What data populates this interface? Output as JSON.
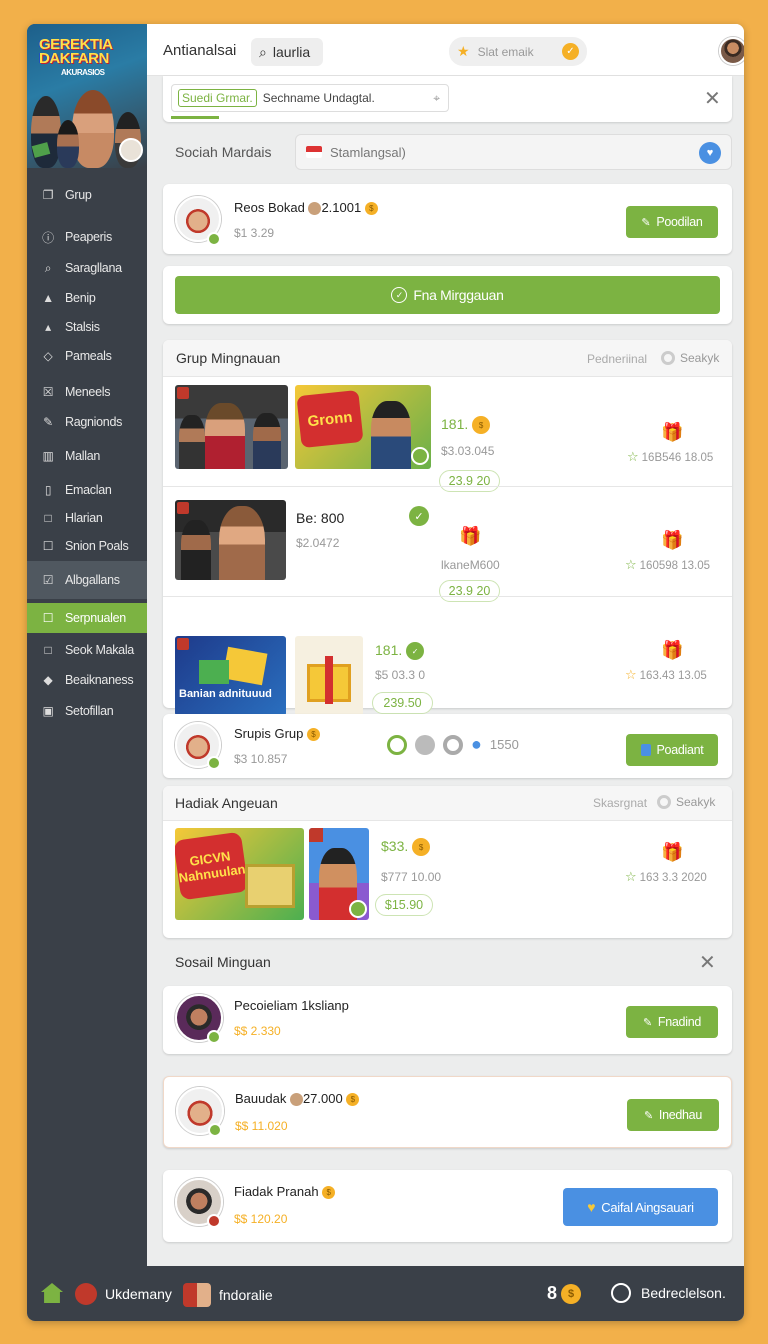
{
  "sidebar": {
    "hero_logo": "GEREKTIA DAKFARN",
    "hero_logo_small": "AKURASIOS",
    "items": [
      {
        "label": "Grup",
        "icon": "bookmark-icon"
      },
      {
        "label": "Peaperis",
        "icon": "info-icon"
      },
      {
        "label": "Saragllana",
        "icon": "search-icon"
      },
      {
        "label": "Benip",
        "icon": "person-icon"
      },
      {
        "label": "Stalsis",
        "icon": "thumb-up-icon"
      },
      {
        "label": "Pameals",
        "icon": "tag-icon"
      },
      {
        "label": "Meneels",
        "icon": "box-icon"
      },
      {
        "label": "Ragnionds",
        "icon": "edit-icon"
      },
      {
        "label": "Mallan",
        "icon": "grid-icon"
      },
      {
        "label": "Emaclan",
        "icon": "columns-icon"
      },
      {
        "label": "Hlarian",
        "icon": "square-icon"
      },
      {
        "label": "Snion Poals",
        "icon": "edit-icon"
      },
      {
        "label": "Albgallans",
        "icon": "checkbox-icon"
      },
      {
        "label": "Serpnualen",
        "icon": "edit-icon"
      },
      {
        "label": "Seok Makala",
        "icon": "square-icon"
      },
      {
        "label": "Beaiknaness",
        "icon": "shield-icon"
      },
      {
        "label": "Setofillan",
        "icon": "calendar-icon"
      }
    ]
  },
  "topbar": {
    "title": "Antianalsai",
    "search_label": "laurlia",
    "pill_text": "Slat emaik"
  },
  "notice": {
    "tag": "Suedi Grmar.",
    "text": "Sechname Undagtal."
  },
  "social_input": {
    "label": "Sociah Mardais",
    "placeholder": "Stamlangsal)"
  },
  "profile1": {
    "name": "Reos Bokad",
    "amount": "2.1001",
    "sub": "$1 3.29",
    "button": "Poodilan"
  },
  "wide_button": {
    "label": "Fna Mirggauan"
  },
  "group_section": {
    "title": "Grup Mingnauan",
    "right_text": "Pedneriinal",
    "right_action": "Seakyk",
    "rows": [
      {
        "name": "181.",
        "sub": "$3.03.045",
        "pill": "23.9 20",
        "stat": "16B546 18.05",
        "thumb_text": "Gronn"
      },
      {
        "name": "Be: 800",
        "sub": "$2.0472",
        "mid_text": "lkaneM600",
        "pill": "23.9 20",
        "stat": "160598 13.05"
      },
      {
        "name": "181.",
        "sub": "$5 03.3 0",
        "pill": "239.50",
        "stat": "163.43 13.05",
        "thumb_text": "Banian adnituuud"
      }
    ]
  },
  "profile2": {
    "name": "Srupis Grup",
    "sub": "$3 10.857",
    "count": "1550",
    "button": "Poadiant"
  },
  "hadiah_section": {
    "title": "Hadiak Angeuan",
    "right_text": "Skasrgnat",
    "right_action": "Seakyk",
    "row": {
      "name": "$33.",
      "sub": "$777 10.00",
      "pill": "$15.90",
      "stat": "163 3.3 2020",
      "thumb_text": "GICVN Nahnuulan"
    }
  },
  "sosial_section": {
    "title": "Sosail Minguan"
  },
  "list": [
    {
      "name": "Pecoieliam 1kslianp",
      "sub": "$$ 2.330",
      "button": "Fnadind"
    },
    {
      "name": "Bauudak",
      "amount": "27.000",
      "sub": "$$ 11.020",
      "button": "Inedhau"
    },
    {
      "name": "Fiadak Pranah",
      "sub": "$$ 120.20",
      "button": "Caifal Aingsauari"
    }
  ],
  "bottom": {
    "home": "",
    "item1": "Ukdemany",
    "item2": "fndoralie",
    "count": "8",
    "right": "Bedreclelson."
  },
  "colors": {
    "accent_green": "#7cb342",
    "accent_blue": "#4a90e2",
    "coin": "#f5b026",
    "sidebar": "#3a4048"
  }
}
